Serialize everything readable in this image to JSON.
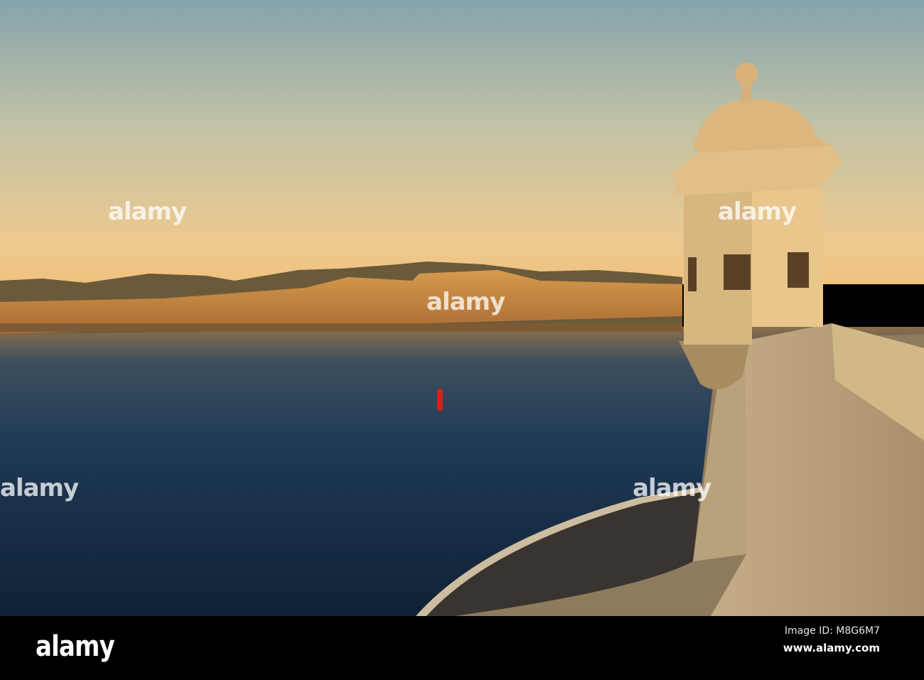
{
  "photo": {
    "subject": "harbour-sunset-watchtower"
  },
  "watermark": {
    "text": "alamy"
  },
  "footer": {
    "logo": "alamy",
    "image_id": "Image ID: M8G6M7",
    "url": "www.alamy.com"
  }
}
